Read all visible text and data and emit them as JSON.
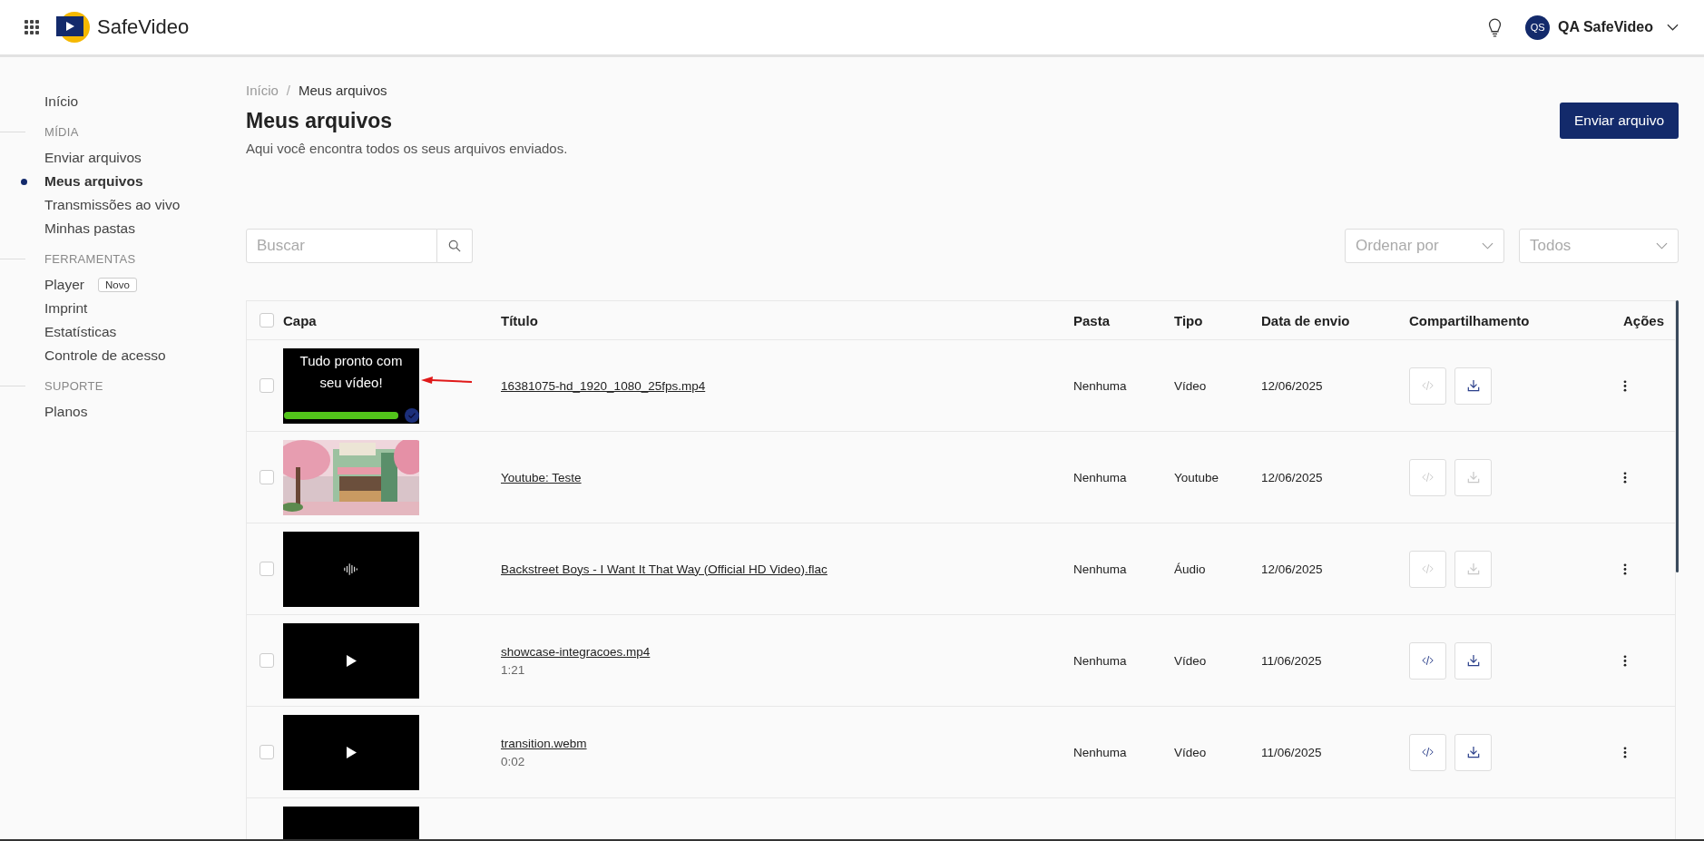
{
  "header": {
    "app_name": "SafeVideo",
    "user": {
      "initials": "QS",
      "name": "QA SafeVideo"
    }
  },
  "sidebar": {
    "groups": [
      {
        "items": [
          {
            "label": "Início",
            "selected": false
          }
        ]
      },
      {
        "title": "MÍDIA",
        "items": [
          {
            "label": "Enviar arquivos",
            "selected": false
          },
          {
            "label": "Meus arquivos",
            "selected": true
          },
          {
            "label": "Transmissões ao vivo",
            "selected": false
          },
          {
            "label": "Minhas pastas",
            "selected": false
          }
        ]
      },
      {
        "title": "FERRAMENTAS",
        "items": [
          {
            "label": "Player",
            "selected": false,
            "badge": "Novo"
          },
          {
            "label": "Imprint",
            "selected": false
          },
          {
            "label": "Estatísticas",
            "selected": false
          },
          {
            "label": "Controle de acesso",
            "selected": false
          }
        ]
      },
      {
        "title": "SUPORTE",
        "items": [
          {
            "label": "Planos",
            "selected": false
          }
        ]
      }
    ]
  },
  "breadcrumb": [
    "Início",
    "Meus arquivos"
  ],
  "breadcrumb_separator": "/",
  "title": "Meus arquivos",
  "subtitle": "Aqui você encontra todos os seus arquivos enviados.",
  "upload_button": "Enviar arquivo",
  "search": {
    "placeholder": "Buscar"
  },
  "filters": [
    {
      "placeholder": "Ordenar por"
    },
    {
      "placeholder": "Todos"
    }
  ],
  "table": {
    "select_all_checked": false,
    "columns": [
      "Capa",
      "Título",
      "Pasta",
      "Tipo",
      "Data de envio",
      "Compartilhamento",
      "Ações"
    ],
    "rows": [
      {
        "checked": false,
        "cover": {
          "kind": "processing",
          "text": "Tudo pronto com seu vídeo!",
          "level": 1,
          "done": true,
          "annotated": true
        },
        "title": "16381075-hd_1920_1080_25fps.mp4",
        "folder": "Nenhuma",
        "type": "Vídeo",
        "date": "12/06/2025",
        "embed_enabled": false,
        "download_enabled": true
      },
      {
        "checked": false,
        "title": "Youtube: Teste",
        "folder": "Nenhuma",
        "type": "Youtube",
        "date": "12/06/2025",
        "embed_enabled": false,
        "download_enabled": false
      },
      {
        "checked": false,
        "cover": {
          "kind": "audio"
        },
        "title": "Backstreet Boys - I Want It That Way (Official HD Video).flac",
        "folder": "Nenhuma",
        "type": "Áudio",
        "date": "12/06/2025",
        "embed_enabled": false,
        "download_enabled": false
      },
      {
        "checked": false,
        "cover": {
          "kind": "video"
        },
        "title": "showcase-integracoes.mp4",
        "duration": "1:21",
        "folder": "Nenhuma",
        "type": "Vídeo",
        "date": "11/06/2025",
        "embed_enabled": true,
        "download_enabled": true
      },
      {
        "checked": false,
        "cover": {
          "kind": "video"
        },
        "title": "transition.webm",
        "duration": "0:02",
        "folder": "Nenhuma",
        "type": "Vídeo",
        "date": "11/06/2025",
        "embed_enabled": true,
        "download_enabled": true
      },
      {
        "cover": {
          "kind": "blank"
        }
      }
    ]
  }
}
